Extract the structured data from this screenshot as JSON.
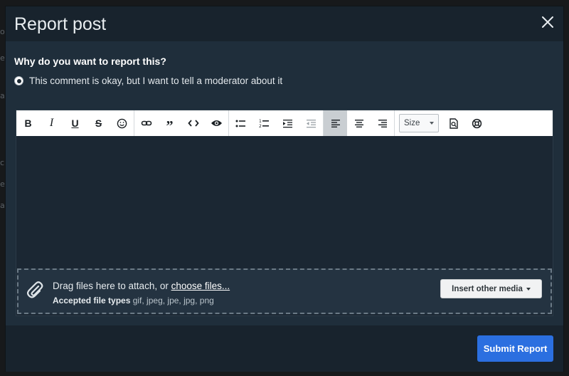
{
  "modal": {
    "title": "Report post",
    "question": "Why do you want to report this?",
    "reason_option": "This comment is okay, but I want to tell a moderator about it"
  },
  "toolbar": {
    "size_label": "Size"
  },
  "attach": {
    "drag_text": "Drag files here to attach, or ",
    "choose_link": "choose files...",
    "accepted_label": "Accepted file types",
    "accepted_types": " gif, jpeg, jpe, jpg, png",
    "insert_media": "Insert other media"
  },
  "footer": {
    "submit_label": "Submit Report"
  },
  "colors": {
    "modal_bg": "#1f2e3b",
    "header_bg": "#18232d",
    "accent": "#2b6fe0"
  }
}
